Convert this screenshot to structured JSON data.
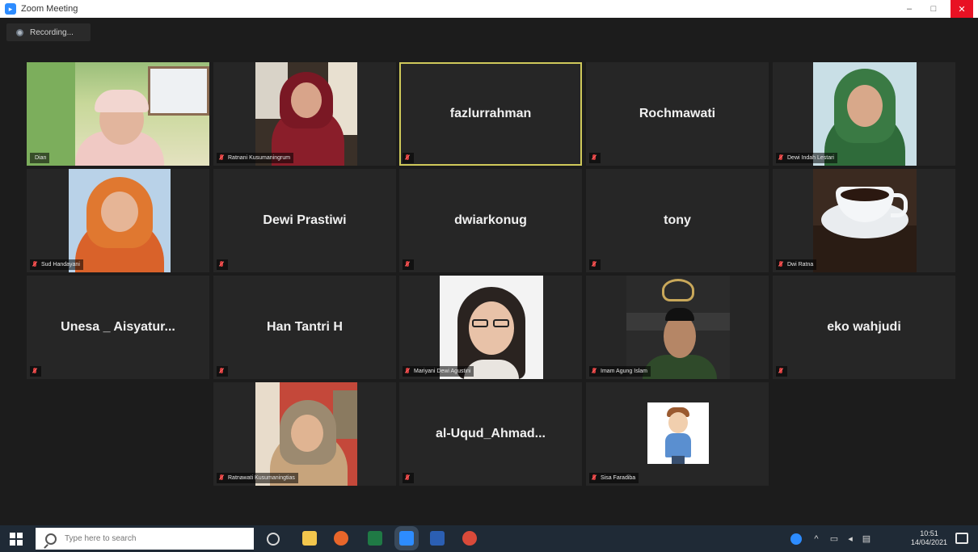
{
  "window": {
    "title": "Zoom Meeting",
    "controls": {
      "minimize": "–",
      "maximize": "□",
      "close": "✕"
    }
  },
  "recording": {
    "label": "Recording..."
  },
  "participants": [
    {
      "name": "",
      "label": "Dian",
      "has_video": true,
      "muted": false,
      "active": false
    },
    {
      "name": "",
      "label": "Ratnani Kusumaningrum",
      "has_video": true,
      "muted": true,
      "active": false
    },
    {
      "name": "fazlurrahman",
      "label": "",
      "has_video": false,
      "muted": true,
      "active": true
    },
    {
      "name": "Rochmawati",
      "label": "",
      "has_video": false,
      "muted": true,
      "active": false
    },
    {
      "name": "",
      "label": "Dewi Indah Lestari",
      "has_video": true,
      "muted": true,
      "active": false
    },
    {
      "name": "",
      "label": "Sud Handayani",
      "has_video": true,
      "muted": true,
      "active": false
    },
    {
      "name": "Dewi Prastiwi",
      "label": "",
      "has_video": false,
      "muted": true,
      "active": false
    },
    {
      "name": "dwiarkonug",
      "label": "",
      "has_video": false,
      "muted": true,
      "active": false
    },
    {
      "name": "tony",
      "label": "",
      "has_video": false,
      "muted": true,
      "active": false
    },
    {
      "name": "",
      "label": "Dwi Ratna",
      "has_video": true,
      "muted": true,
      "active": false
    },
    {
      "name": "Unesa _ Aisyatur...",
      "label": "",
      "has_video": false,
      "muted": true,
      "active": false
    },
    {
      "name": "Han Tantri H",
      "label": "",
      "has_video": false,
      "muted": true,
      "active": false
    },
    {
      "name": "",
      "label": "Mariyani Dewi Agustini",
      "has_video": true,
      "muted": true,
      "active": false
    },
    {
      "name": "",
      "label": "Imam Agung Islam",
      "has_video": true,
      "muted": true,
      "active": false
    },
    {
      "name": "eko wahjudi",
      "label": "",
      "has_video": false,
      "muted": true,
      "active": false
    },
    {
      "name": "",
      "label": "Ratnawati Kusumaningtias",
      "has_video": true,
      "muted": true,
      "active": false
    },
    {
      "name": "al-Uqud_Ahmad...",
      "label": "",
      "has_video": false,
      "muted": true,
      "active": false
    },
    {
      "name": "",
      "label": "Sisa Faradiba",
      "has_video": true,
      "muted": true,
      "active": false
    }
  ],
  "taskbar": {
    "search_placeholder": "Type here to search",
    "clock_time": "10:51",
    "clock_date": "14/04/2021",
    "icons": [
      "task-view-icon",
      "file-explorer-icon",
      "firefox-icon",
      "excel-icon",
      "zoom-icon",
      "word-icon",
      "chrome-icon"
    ],
    "tray": [
      "zoom-tray-icon",
      "chevron-up-icon",
      "network-icon",
      "volume-icon",
      "keyboard-icon"
    ]
  },
  "colors": {
    "active_border": "#cfc95a",
    "muted_icon": "#d03a3a",
    "taskbar": "#1f2a36"
  }
}
